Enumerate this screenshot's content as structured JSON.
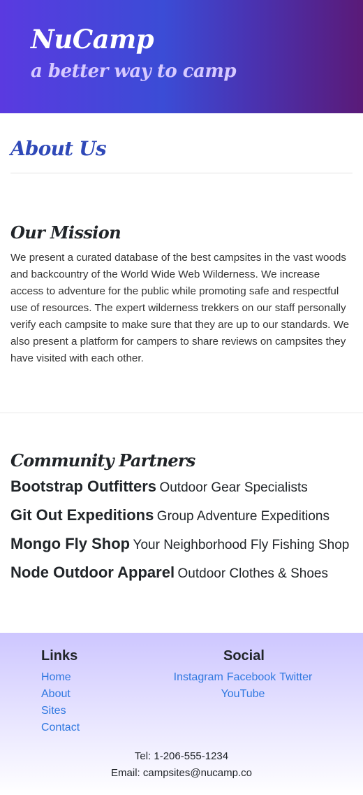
{
  "header": {
    "brand": "NuCamp",
    "tagline": "a better way to camp"
  },
  "page": {
    "title": "About Us"
  },
  "mission": {
    "title": "Our Mission",
    "text": "We present a curated database of the best campsites in the vast woods and backcountry of the World Wide Web Wilderness. We increase access to adventure for the public while promoting safe and respectful use of resources. The expert wilderness trekkers on our staff personally verify each campsite to make sure that they are up to our standards. We also present a platform for campers to share reviews on campsites they have visited with each other."
  },
  "partners": {
    "title": "Community Partners",
    "items": [
      {
        "name": "Bootstrap Outfitters",
        "description": "Outdoor Gear Specialists"
      },
      {
        "name": "Git Out Expeditions",
        "description": "Group Adventure Expeditions"
      },
      {
        "name": "Mongo Fly Shop",
        "description": "Your Neighborhood Fly Fishing Shop"
      },
      {
        "name": "Node Outdoor Apparel",
        "description": "Outdoor Clothes & Shoes"
      }
    ]
  },
  "footer": {
    "links_heading": "Links",
    "links": [
      "Home",
      "About",
      "Sites",
      "Contact"
    ],
    "social_heading": "Social",
    "social": [
      "Instagram",
      "Facebook",
      "Twitter",
      "YouTube"
    ],
    "tel": "Tel: 1-206-555-1234",
    "email": "Email: campsites@nucamp.co"
  },
  "colors": {
    "brand_blue": "#2f49b8",
    "link": "#2f78e0"
  }
}
